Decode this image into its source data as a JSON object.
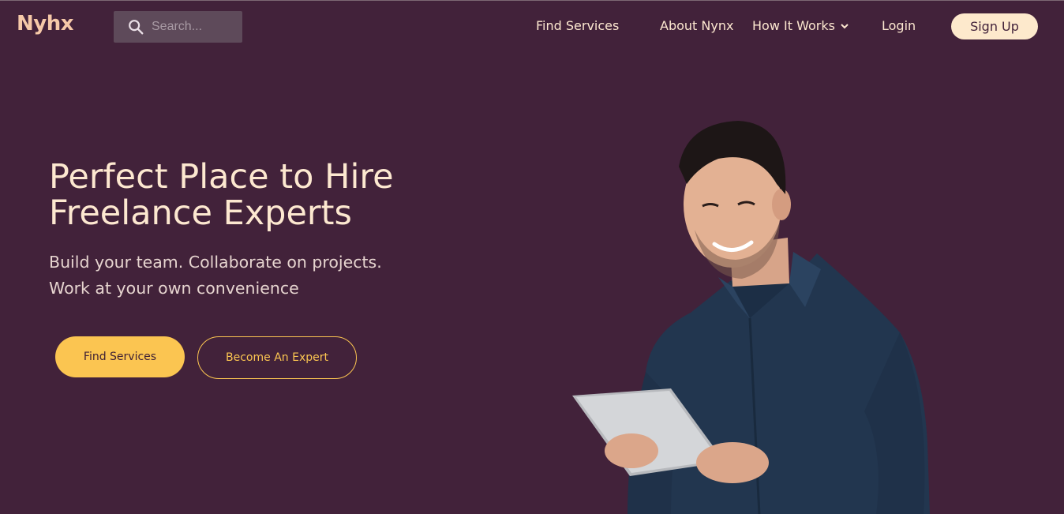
{
  "brand": {
    "logo_text": "Nyhx"
  },
  "search": {
    "placeholder": "Search..."
  },
  "nav": {
    "find_services": "Find Services",
    "about": "About Nynx",
    "how_it_works": "How It Works",
    "login": "Login",
    "signup": "Sign Up"
  },
  "hero": {
    "title_line1": "Perfect Place to Hire",
    "title_line2": "Freelance Experts",
    "subtitle_line1": "Build your team. Collaborate on projects.",
    "subtitle_line2": "Work at your own convenience",
    "primary_button": "Find Services",
    "secondary_button": "Become An Expert"
  },
  "icons": {
    "search": "search-icon",
    "dropdown": "chevron-down-icon"
  },
  "colors": {
    "background": "#42223a",
    "accent": "#fbc551",
    "text": "#fde8d0",
    "signup_bg": "#fde9cc",
    "logo": "#f6c9a8"
  }
}
